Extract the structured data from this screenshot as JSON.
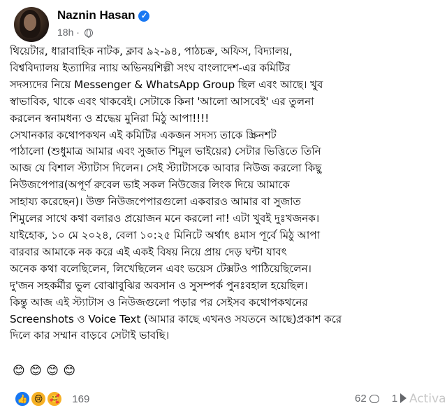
{
  "post": {
    "author": "Naznin Hasan",
    "verified": true,
    "time": "18h",
    "dot": "·",
    "visibility_icon": "globe-icon",
    "body": "থিয়েটার, ধারাবাহিক নাটক, ক্লাব ৯২-৯৪, পাঠচক্র, অফিস, বিদ্যালয়,\nবিশ্ববিদ্যালয় ইত্যাদির ন্যায় অভিনয়শিল্পী সংঘ বাংলাদেশ-এর কমিটির\nসদস্যদের নিয়ে Messenger & WhatsApp Group ছিল এবং আছে। খুব\nস্বাভাবিক, থাকে এবং থাকবেই। সেটাকে কিনা 'আলো আসবেই' এর তুলনা\nকরলেন স্বনামধন্য ও শ্রদ্ধেয় মুনিরা মিঠু আপা!!!!\nসেখানকার কথোপকথন এই কমিটির একজন সদস্য তাকে স্ক্রিনশট\nপাঠালো (শুধুমাত্র আমার এবং সুজাত শিমুল ভাইয়ের) সেটার ভিত্তিতে তিনি\nআজ যে বিশাল স্ট্যাটাস দিলেন। সেই স্ট্যাটাসকে আবার নিউজ করলো কিছু\nনিউজপেপার(অপূর্ণ রুবেল ভাই সকল নিউজের লিংক দিয়ে আমাকে\nসাহায্য করেছেন)। উক্ত নিউজপেপারগুলো একবারও আমার বা সুজাত\nশিমুলের সাথে কথা বলারও প্রয়োজন মনে করলো না! এটা খুবই দুঃখজনক।\nযাইহোক, ১০ মে ২০২৪, বেলা ১০:২৫ মিনিটে অর্থাৎ ৪মাস পূর্বে মিঠু আপা\nবারবার আমাকে নক করে এই একই বিষয় নিয়ে প্রায় দেড় ঘন্টা যাবৎ\nঅনেক কথা বলেছিলেন, লিখেছিলেন এবং ভয়েস টেক্সটও পাঠিয়েছিলেন।\nদু'জন সহকর্মীর ভুল বোঝাবুঝির অবসান ও সুসম্পর্ক পুনঃবহাল হয়েছিল।\nকিন্তু আজ এই স্ট্যাটাস ও নিউজগুলো পড়ার পর সেইসব কথোপকথনের\nScreenshots ও Voice Text (আমার কাছে এখনও সযতনে আছে)প্রকাশ করে\nদিলে কার সম্মান বাড়বে সেটাই ভাবছি।",
    "emojis": [
      "😊",
      "😊",
      "😊",
      "😊"
    ]
  },
  "stats": {
    "reaction_icons": [
      "👍",
      "😢",
      "🥰"
    ],
    "reaction_count": "169",
    "comment_count": "62",
    "share_count": "1"
  },
  "overlay": {
    "watermark": "Activa"
  }
}
